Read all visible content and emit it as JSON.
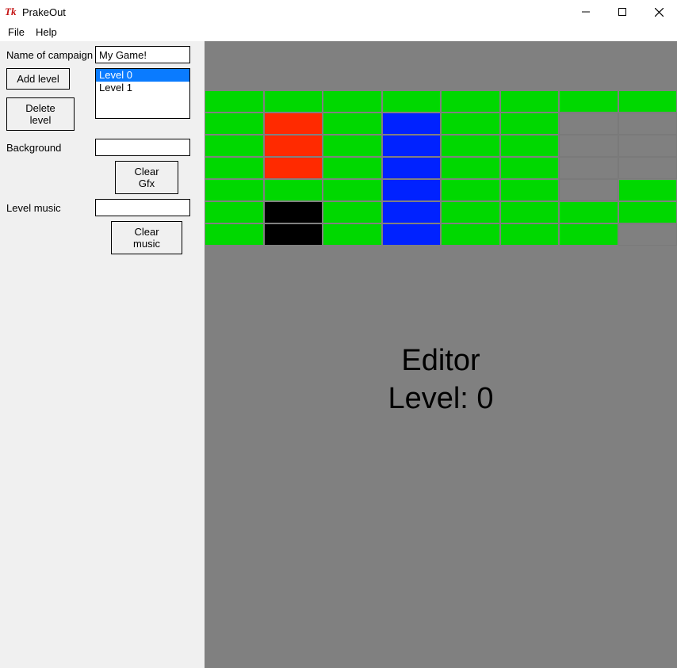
{
  "window": {
    "title": "PrakeOut",
    "minimize_glyph": "—",
    "maximize_glyph": "▢",
    "close_glyph": "✕"
  },
  "menu": {
    "file": "File",
    "help": "Help"
  },
  "sidebar": {
    "campaign_label": "Name of campaign",
    "campaign_value": "My Game!",
    "add_level": "Add level",
    "delete_level": "Delete level",
    "levels": [
      "Level 0",
      "Level 1"
    ],
    "selected_level_index": 0,
    "background_label": "Background",
    "background_value": "",
    "clear_gfx": "Clear Gfx",
    "level_music_label": "Level music",
    "level_music_value": "",
    "clear_music": "Clear music"
  },
  "editor": {
    "title_line1": "Editor",
    "title_line2": "Level: 0",
    "cols": 8,
    "rows": 7,
    "grid": [
      [
        "green",
        "green",
        "green",
        "green",
        "green",
        "green",
        "green",
        "green"
      ],
      [
        "green",
        "red",
        "green",
        "blue",
        "green",
        "green",
        "grey",
        "grey"
      ],
      [
        "green",
        "red",
        "green",
        "blue",
        "green",
        "green",
        "grey",
        "grey"
      ],
      [
        "green",
        "red",
        "green",
        "blue",
        "green",
        "green",
        "grey",
        "grey"
      ],
      [
        "green",
        "green",
        "green",
        "blue",
        "green",
        "green",
        "grey",
        "green"
      ],
      [
        "green",
        "black",
        "green",
        "blue",
        "green",
        "green",
        "green",
        "green"
      ],
      [
        "green",
        "black",
        "green",
        "blue",
        "green",
        "green",
        "green",
        "grey"
      ]
    ]
  }
}
